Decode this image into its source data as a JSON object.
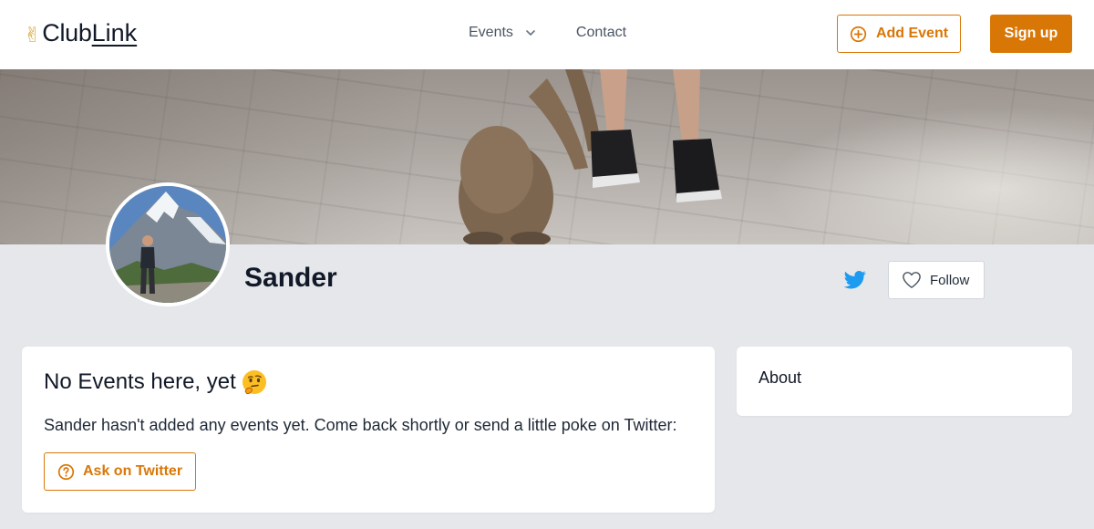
{
  "header": {
    "logo_emoji": "✌",
    "logo_club": "Club",
    "logo_link": "Link",
    "nav": [
      {
        "label": "Events",
        "icon": "chevron-down-icon"
      },
      {
        "label": "Contact"
      }
    ],
    "add_event_label": "Add Event",
    "add_event_icon": "plus-circle-icon",
    "signup_label": "Sign up"
  },
  "profile": {
    "name": "Sander",
    "twitter_icon": "twitter-icon",
    "follow_label": "Follow",
    "follow_icon": "heart-icon"
  },
  "events": {
    "title": "No Events here, yet",
    "title_emoji": "thinking-face-icon",
    "message": "Sander hasn't added any events yet. Come back shortly or send a little poke on Twitter:",
    "ask_label": "Ask on Twitter",
    "ask_icon": "question-circle-icon"
  },
  "about": {
    "title": "About"
  },
  "colors": {
    "accent": "#d97706",
    "twitter": "#1d9bf0",
    "page_bg": "#e5e7eb",
    "card_bg": "#ffffff"
  }
}
